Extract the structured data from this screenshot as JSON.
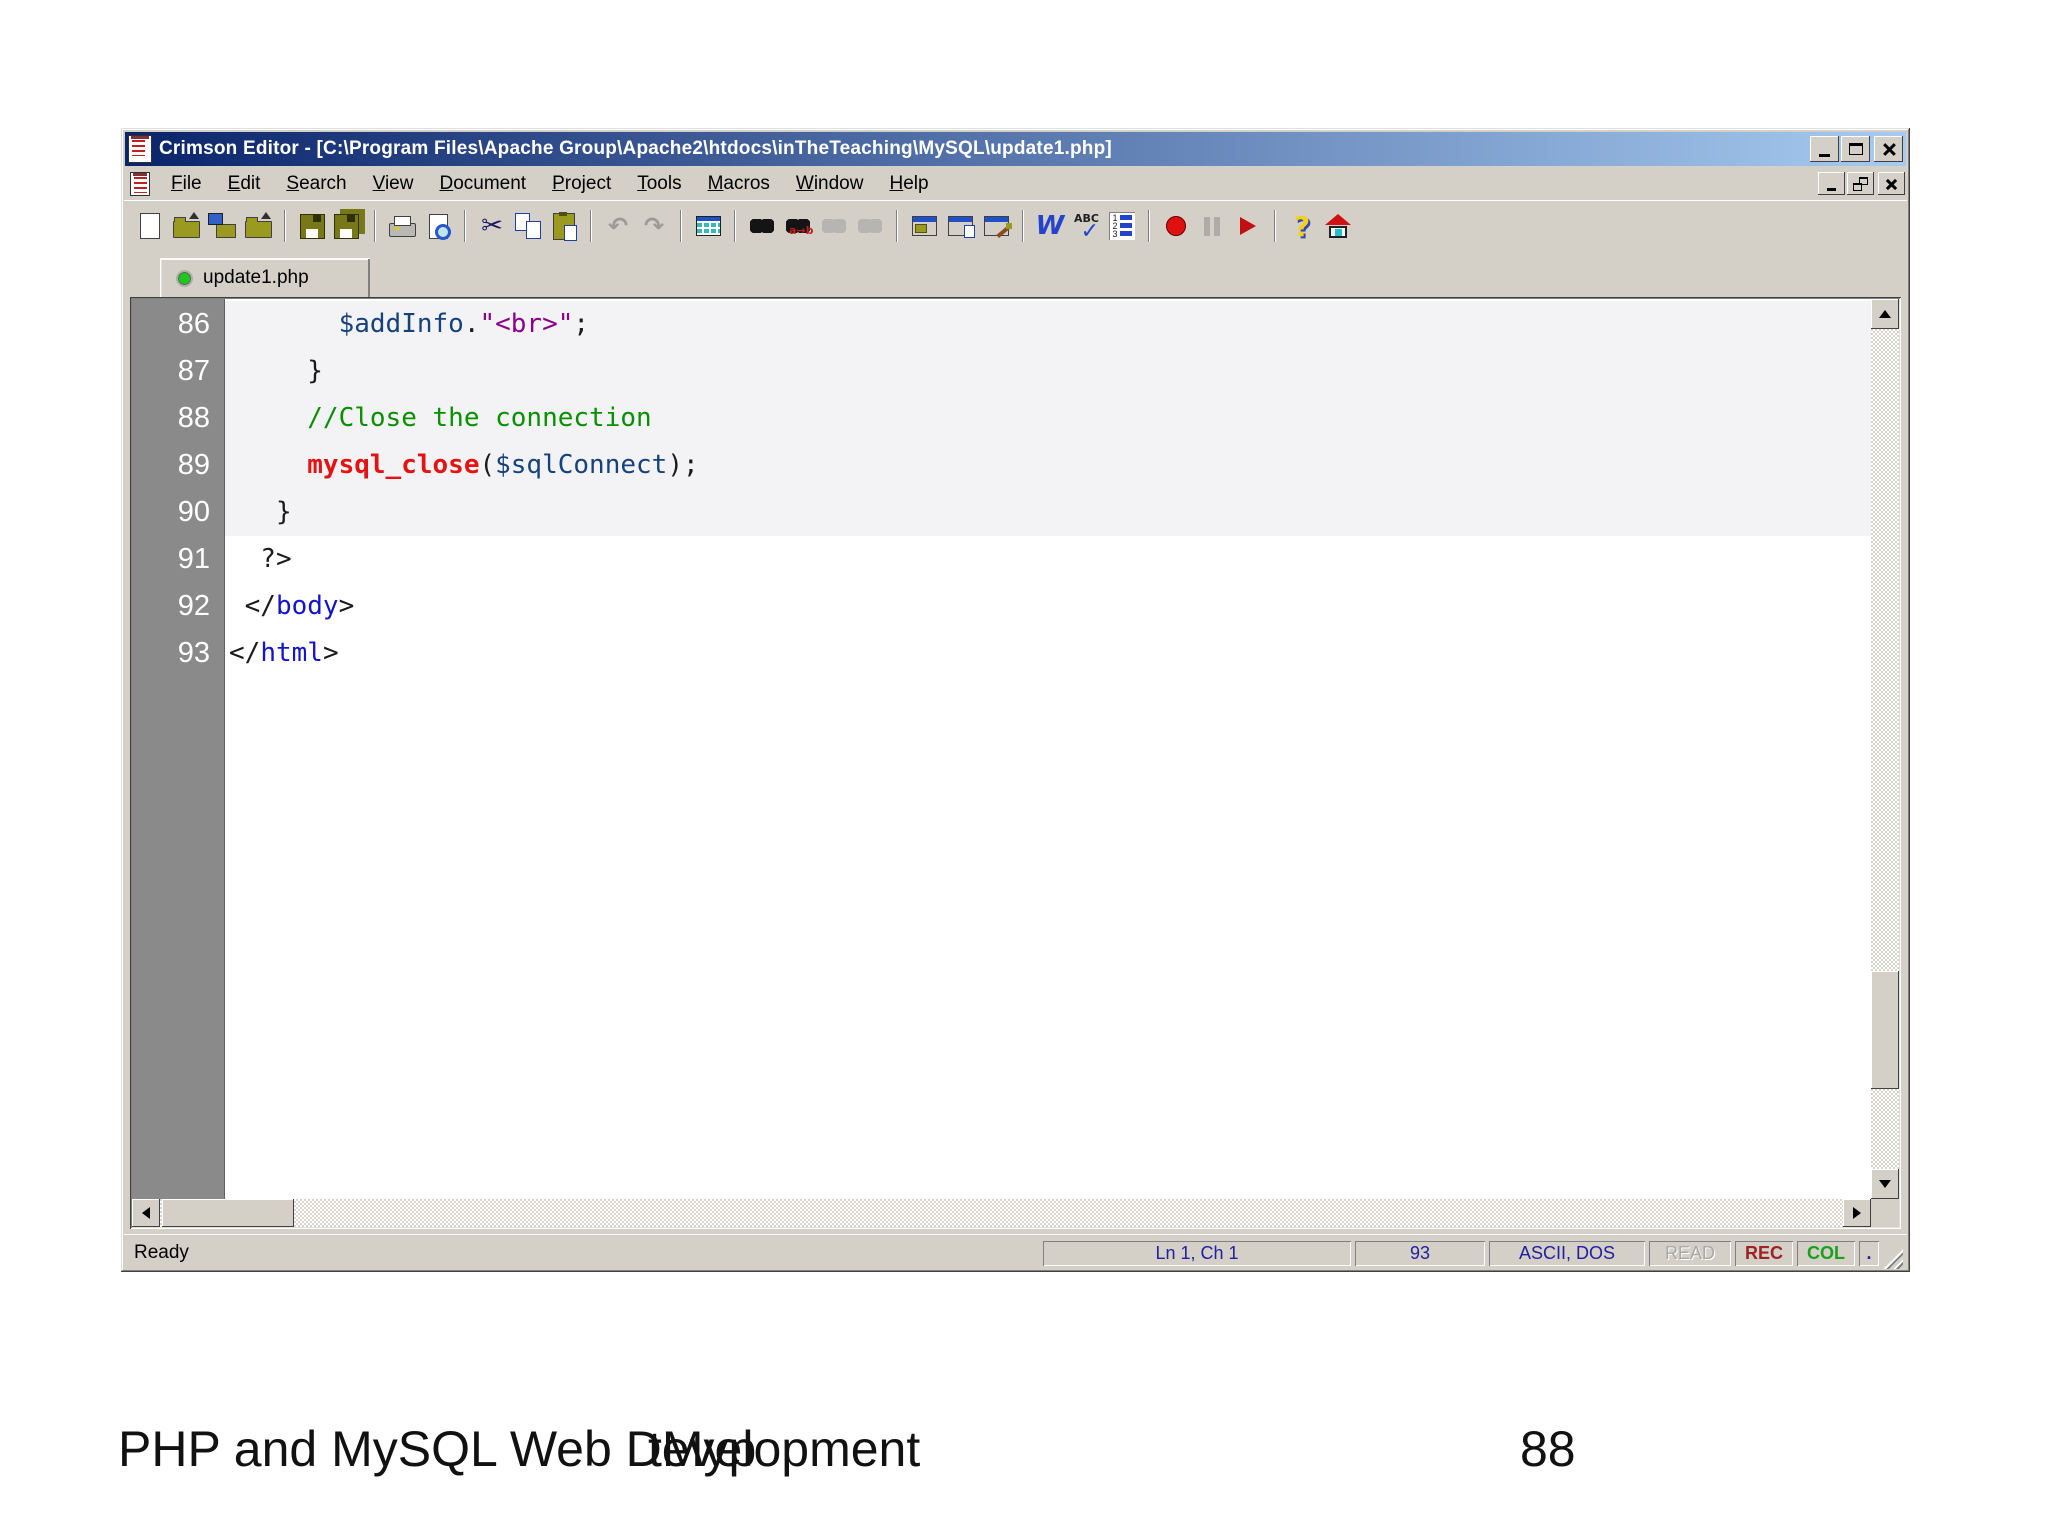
{
  "window": {
    "title": "Crimson Editor - [C:\\Program Files\\Apache Group\\Apache2\\htdocs\\inTheTeaching\\MySQL\\update1.php]"
  },
  "menu": {
    "items": [
      "File",
      "Edit",
      "Search",
      "View",
      "Document",
      "Project",
      "Tools",
      "Macros",
      "Window",
      "Help"
    ]
  },
  "toolbar": {
    "groups": [
      [
        {
          "name": "new-file"
        },
        {
          "name": "open-file"
        },
        {
          "name": "open-ftp"
        },
        {
          "name": "close-file"
        }
      ],
      [
        {
          "name": "save"
        },
        {
          "name": "save-all"
        }
      ],
      [
        {
          "name": "print"
        },
        {
          "name": "print-preview"
        }
      ],
      [
        {
          "name": "cut"
        },
        {
          "name": "copy"
        },
        {
          "name": "paste"
        }
      ],
      [
        {
          "name": "undo",
          "disabled": true
        },
        {
          "name": "redo",
          "disabled": true
        }
      ],
      [
        {
          "name": "insert-table"
        }
      ],
      [
        {
          "name": "find"
        },
        {
          "name": "replace"
        },
        {
          "name": "find-next",
          "disabled": true
        },
        {
          "name": "find-prev",
          "disabled": true
        }
      ],
      [
        {
          "name": "file-window"
        },
        {
          "name": "clipboard-window"
        },
        {
          "name": "output-window"
        }
      ],
      [
        {
          "name": "word-wrap"
        },
        {
          "name": "spell-check"
        },
        {
          "name": "line-numbers"
        }
      ],
      [
        {
          "name": "record-macro"
        },
        {
          "name": "pause-macro",
          "disabled": true
        },
        {
          "name": "play-macro"
        }
      ],
      [
        {
          "name": "help"
        },
        {
          "name": "home"
        }
      ]
    ]
  },
  "tab": {
    "label": "update1.php"
  },
  "editor": {
    "lines": [
      {
        "number": "86",
        "tint": true,
        "segments": [
          {
            "text": "       ",
            "style": "plain"
          },
          {
            "text": "$addInfo",
            "style": "variable"
          },
          {
            "text": ".",
            "style": "plain"
          },
          {
            "text": "\"<br>\"",
            "style": "string"
          },
          {
            "text": ";",
            "style": "plain"
          }
        ]
      },
      {
        "number": "87",
        "tint": true,
        "segments": [
          {
            "text": "     }",
            "style": "plain"
          }
        ]
      },
      {
        "number": "88",
        "tint": true,
        "segments": [
          {
            "text": "     ",
            "style": "plain"
          },
          {
            "text": "//Close the connection",
            "style": "comment"
          }
        ]
      },
      {
        "number": "89",
        "tint": true,
        "segments": [
          {
            "text": "     ",
            "style": "plain"
          },
          {
            "text": "mysql_close",
            "style": "function"
          },
          {
            "text": "(",
            "style": "plain"
          },
          {
            "text": "$sqlConnect",
            "style": "variable"
          },
          {
            "text": ");",
            "style": "plain"
          }
        ]
      },
      {
        "number": "90",
        "tint": true,
        "segments": [
          {
            "text": "   }",
            "style": "plain"
          }
        ]
      },
      {
        "number": "91",
        "tint": false,
        "segments": [
          {
            "text": "  ?>",
            "style": "plain"
          }
        ]
      },
      {
        "number": "92",
        "tint": false,
        "segments": [
          {
            "text": " </",
            "style": "plain"
          },
          {
            "text": "body",
            "style": "tag"
          },
          {
            "text": ">",
            "style": "plain"
          }
        ]
      },
      {
        "number": "93",
        "tint": false,
        "segments": [
          {
            "text": "</",
            "style": "plain"
          },
          {
            "text": "html",
            "style": "tag"
          },
          {
            "text": ">",
            "style": "plain"
          }
        ]
      }
    ]
  },
  "statusbar": {
    "ready": "Ready",
    "position": "Ln 1, Ch 1",
    "line_count": "93",
    "encoding": "ASCII, DOS",
    "read_flag": "READ",
    "rec_flag": "REC",
    "col_flag": "COL",
    "dot": "."
  },
  "footer": {
    "title": "PHP and MySQL Web Development",
    "overlay": "tMyp",
    "page_number": "88"
  },
  "colors": {
    "title_gradient_left": "#0a246a",
    "title_gradient_right": "#a6caf0",
    "chrome": "#d4d0c8",
    "gutter": "#8a8a8a",
    "tint_band": "#f3f3f6",
    "variable": "#16427c",
    "string": "#8b008b",
    "comment": "#089000",
    "function": "#e51212",
    "tag": "#1414c8"
  }
}
